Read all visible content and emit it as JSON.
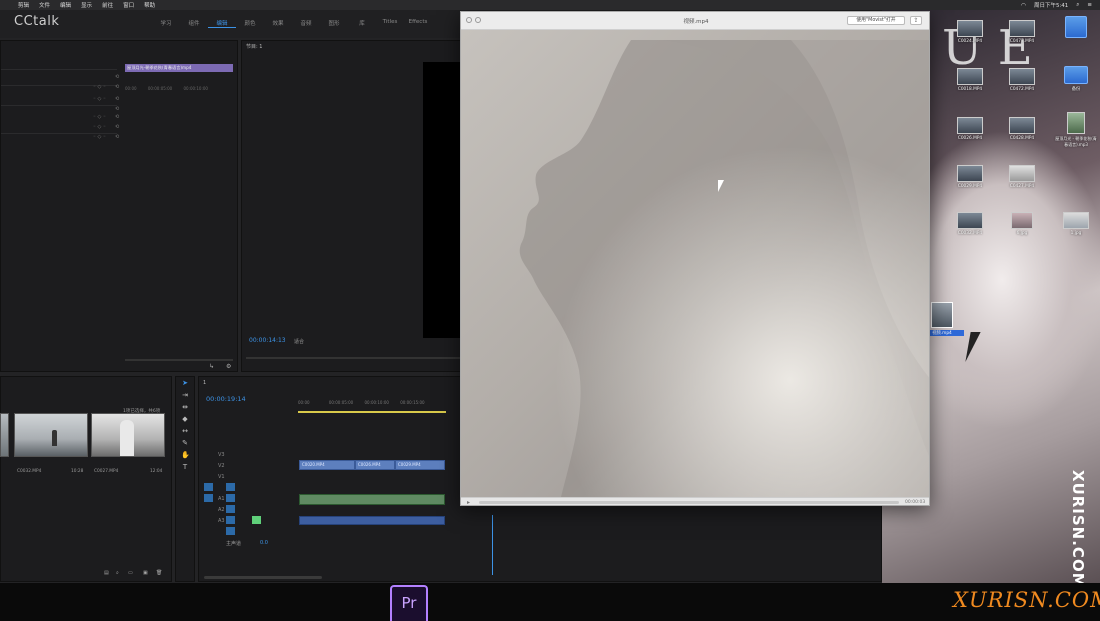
{
  "menubar": {
    "items": [
      "",
      "剪辑",
      "文件",
      "编辑",
      "显示",
      "前往",
      "窗口",
      "帮助"
    ],
    "right": [
      "周日下午5:41"
    ]
  },
  "premiere": {
    "logo": "CCtalk",
    "workspace_tabs": [
      "学习",
      "组件",
      "编辑",
      "颜色",
      "效果",
      "音频",
      "图形",
      "库",
      "Titles",
      "Effects"
    ],
    "active_tab_index": 2,
    "effect_clip_name": "屋顶月光-朝季花秋(青春语言)mp4",
    "effect_ruler": [
      "00:00",
      "00:00:05:00",
      "00:00:10:00"
    ],
    "program_tab": "节目: 1",
    "program_time": "00:00:14:13",
    "program_fit": "适合",
    "project_summary": "1项已选择，共6项",
    "thumbs": [
      {
        "label": "C0032.MP4",
        "dur": "10:28"
      },
      {
        "label": "C0027.MP4",
        "dur": "12:04"
      }
    ],
    "timeline_tab": "1",
    "timeline_time": "00:00:19:14",
    "timeline_ruler": [
      "00:00",
      "00:00:05:00",
      "00:00:10:00",
      "00:00:15:00"
    ],
    "video_clips": [
      "C0020.MP4",
      "C0026.MP4",
      "C0029.MP4"
    ],
    "master_label": "主声道",
    "master_value": "0.0",
    "track_labels": [
      "V3",
      "V2",
      "V1",
      "A1",
      "A2",
      "A3"
    ]
  },
  "quicklook": {
    "title": "视频.mp4",
    "open_with": "使用\"Movist\"打开",
    "share_icon": "share-icon",
    "time": "00:00:03"
  },
  "desktop": {
    "icons": [
      {
        "label": "C0024.MP4",
        "kind": "video"
      },
      {
        "label": "C0477.MP4",
        "kind": "video"
      },
      {
        "label": "",
        "kind": "folder"
      },
      {
        "label": "C0018.MP4",
        "kind": "video"
      },
      {
        "label": "C0472.MP4",
        "kind": "video"
      },
      {
        "label": "备份",
        "kind": "folder"
      },
      {
        "label": "C0026.MP4",
        "kind": "video"
      },
      {
        "label": "C0428.MP4",
        "kind": "video"
      },
      {
        "label": "屋顶月光 - 朝季花秋(青春语言).mp3",
        "kind": "image"
      },
      {
        "label": "C0029.MP4",
        "kind": "video"
      },
      {
        "label": "C0427.MP4",
        "kind": "video"
      },
      {
        "label": "C0032.MP4",
        "kind": "video"
      },
      {
        "label": "6.jpg",
        "kind": "image"
      },
      {
        "label": "1.jpg",
        "kind": "image"
      },
      {
        "label": "视频.mp4",
        "kind": "video"
      }
    ]
  },
  "watermarks": {
    "vertical": "XURISN.COM",
    "bottom": "XURISN.COM"
  },
  "dock": {
    "premiere_icon_label": "Pr"
  }
}
